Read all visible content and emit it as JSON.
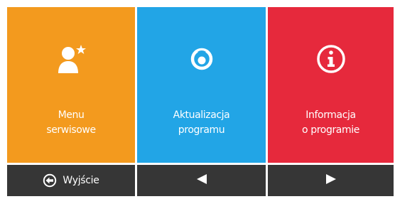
{
  "tiles": {
    "service": {
      "line1": "Menu",
      "line2": "serwisowe",
      "color": "#f39a1e",
      "icon": "service-technician-star-icon"
    },
    "update": {
      "line1": "Aktualizacja",
      "line2": "programu",
      "color": "#22a5e6",
      "icon": "update-disc-icon"
    },
    "info": {
      "line1": "Informacja",
      "line2": "o programie",
      "color": "#e6293c",
      "icon": "info-icon"
    }
  },
  "bottom_bar": {
    "exit_label": "Wyjście",
    "exit_icon": "exit-arrow-icon",
    "prev_icon": "triangle-left-icon",
    "next_icon": "triangle-right-icon",
    "color": "#363636"
  }
}
